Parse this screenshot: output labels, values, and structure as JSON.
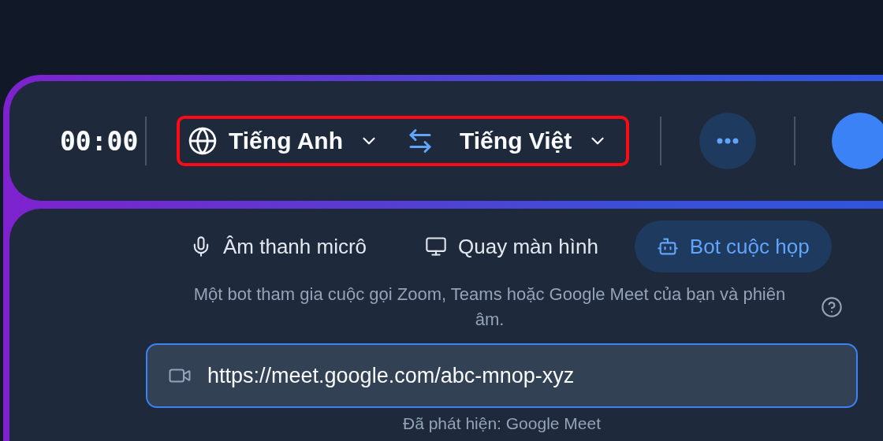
{
  "toolbar": {
    "timer": "00:00",
    "languages": {
      "highlighted": true,
      "source": "Tiếng Anh",
      "target": "Tiếng Việt"
    }
  },
  "source_tabs": [
    {
      "kind": "microphone",
      "label": "Âm thanh micrô",
      "selected": false
    },
    {
      "kind": "screen",
      "label": "Quay màn hình",
      "selected": false
    },
    {
      "kind": "bot",
      "label": "Bot cuộc họp",
      "selected": true
    }
  ],
  "description": "Một bot tham gia cuộc gọi Zoom, Teams hoặc Google Meet của bạn và phiên âm.",
  "meeting_link": {
    "value": "https://meet.google.com/abc-mnop-xyz",
    "focused": true
  },
  "detected": "Đã phát hiện: Google Meet"
}
